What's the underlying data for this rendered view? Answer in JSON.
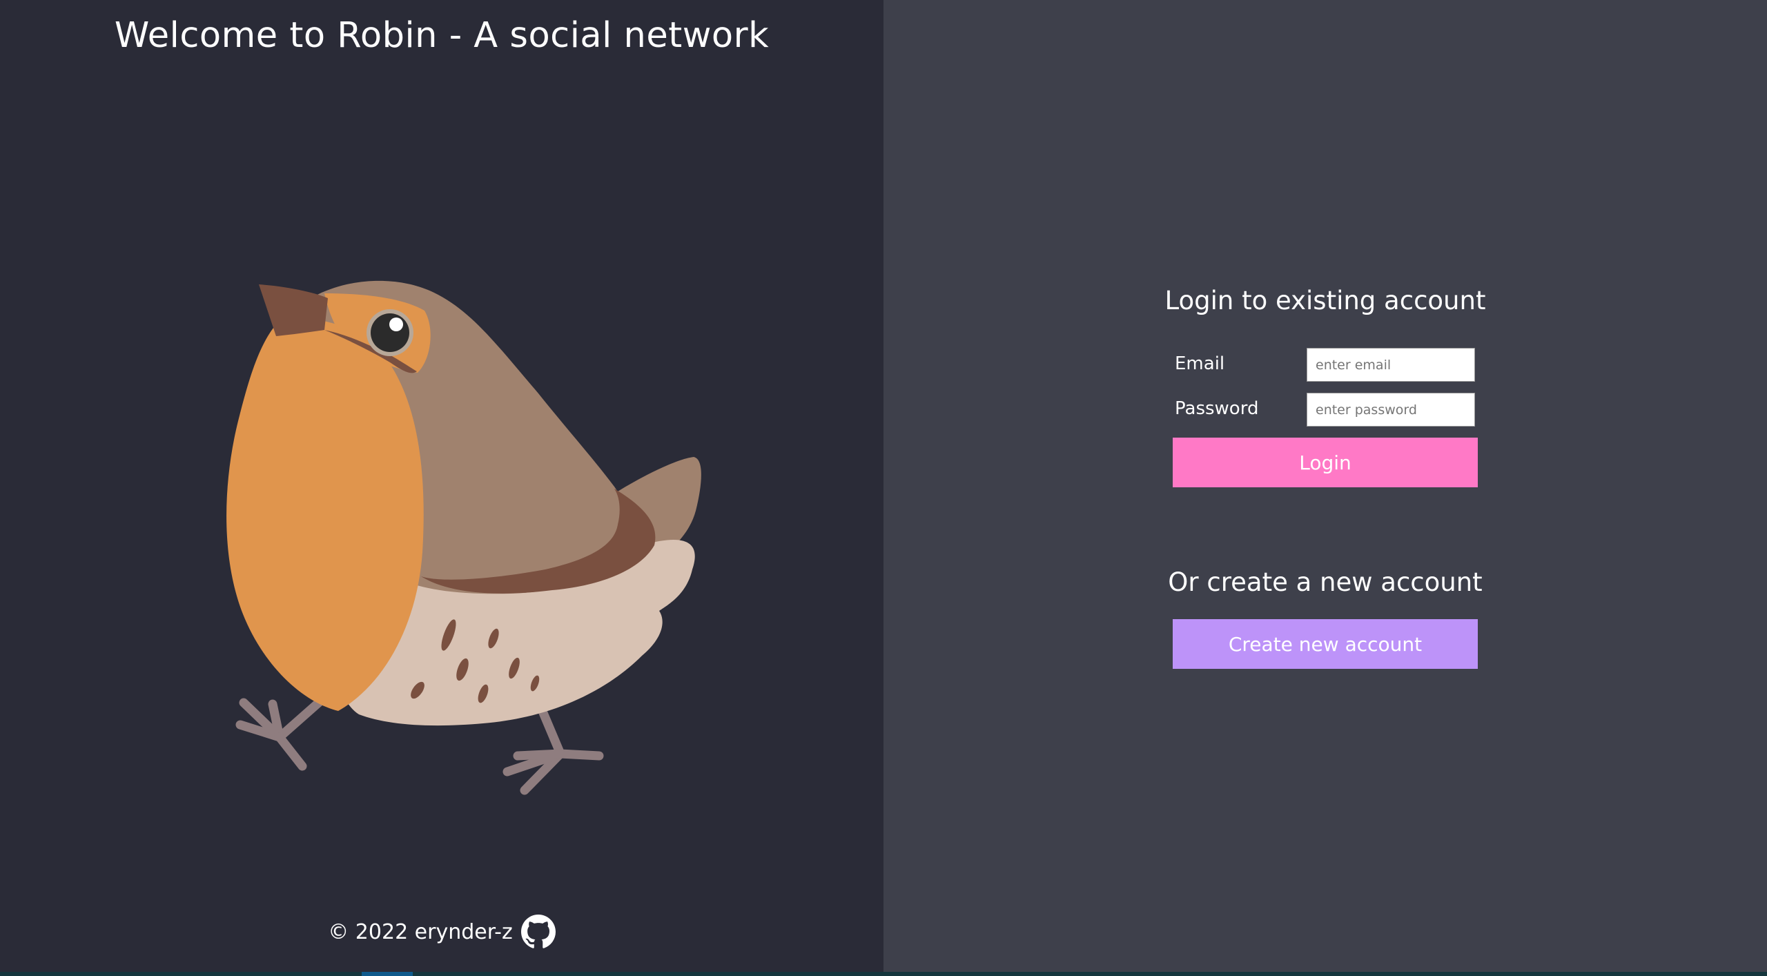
{
  "header": {
    "title": "Welcome to Robin - A social network"
  },
  "footer": {
    "copyright": "© 2022 erynder-z",
    "icon": "github-icon"
  },
  "login": {
    "title": "Login to existing account",
    "email_label": "Email",
    "email_placeholder": "enter email",
    "email_value": "",
    "password_label": "Password",
    "password_placeholder": "enter password",
    "password_value": "",
    "button_label": "Login"
  },
  "signup": {
    "title": "Or create a new account",
    "button_label": "Create new account"
  },
  "colors": {
    "left_background": "#2a2b37",
    "right_background": "#3e404b",
    "login_button": "#ff79c6",
    "create_button": "#bd93f9",
    "robin_breast": "#e0954d",
    "robin_body": "#a0826e",
    "robin_belly": "#d8c2b3",
    "robin_dark": "#7a5040"
  }
}
